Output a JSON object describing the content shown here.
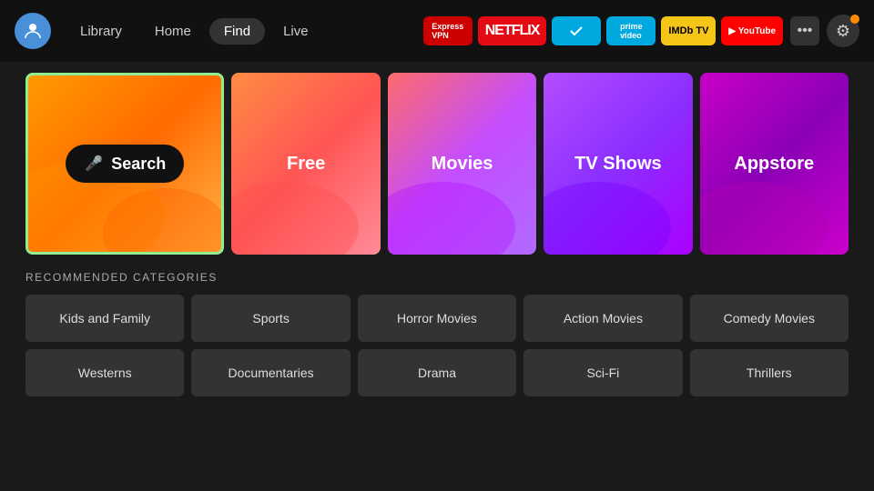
{
  "header": {
    "nav": {
      "library": "Library",
      "home": "Home",
      "find": "Find",
      "live": "Live"
    },
    "apps": [
      {
        "id": "expressvpn",
        "label": "ExpressVPN",
        "class": "badge-express"
      },
      {
        "id": "netflix",
        "label": "NETFLIX",
        "class": "badge-netflix"
      },
      {
        "id": "freevee",
        "label": "▶",
        "class": "badge-freevee"
      },
      {
        "id": "prime",
        "label": "prime video",
        "class": "badge-prime"
      },
      {
        "id": "imdb",
        "label": "IMDb TV",
        "class": "badge-imdb"
      },
      {
        "id": "youtube",
        "label": "▶ YouTube",
        "class": "badge-youtube"
      }
    ],
    "more_label": "•••",
    "settings_label": "⚙"
  },
  "tiles": [
    {
      "id": "search",
      "label": "Search",
      "type": "search"
    },
    {
      "id": "free",
      "label": "Free",
      "type": "normal"
    },
    {
      "id": "movies",
      "label": "Movies",
      "type": "normal"
    },
    {
      "id": "tvshows",
      "label": "TV Shows",
      "type": "normal"
    },
    {
      "id": "appstore",
      "label": "Appstore",
      "type": "normal"
    }
  ],
  "recommended": {
    "title": "RECOMMENDED CATEGORIES",
    "row1": [
      "Kids and Family",
      "Sports",
      "Horror Movies",
      "Action Movies",
      "Comedy Movies"
    ],
    "row2": [
      "Westerns",
      "Documentaries",
      "Drama",
      "Sci-Fi",
      "Thrillers"
    ]
  }
}
